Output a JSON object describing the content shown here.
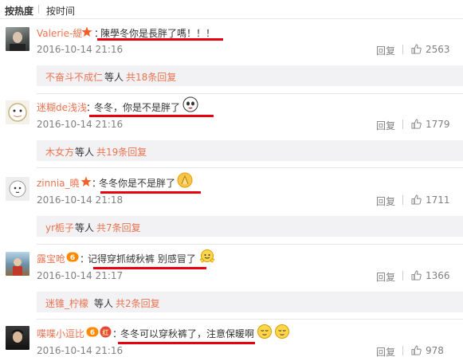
{
  "tabs": {
    "hot": "按热度",
    "time": "按时间"
  },
  "colors": {
    "accent": "#eb7350",
    "underline": "#e60012",
    "muted": "#808080",
    "sub_bg": "#f2f2f5"
  },
  "comments": [
    {
      "nickname": "Valerie-緹",
      "badges": [
        "star-icon"
      ],
      "text": "陳學冬你是長胖了嗎！！！",
      "emojis": [],
      "time": "2016-10-14 21:16",
      "reply_label": "回复",
      "likes": "2563",
      "sub_names": "不奋斗不成仁",
      "sub_deng": "等人",
      "sub_total": "共18条回复"
    },
    {
      "nickname": "迷糊de浅浅",
      "badges": [],
      "text": "冬冬，你是不是胖了",
      "emojis": [
        "doge-emoji"
      ],
      "time": "2016-10-14 21:16",
      "reply_label": "回复",
      "likes": "1779",
      "sub_names": "木女方",
      "sub_deng": "等人",
      "sub_total": "共19条回复"
    },
    {
      "nickname": "zinnia_曉",
      "badges": [
        "star-icon"
      ],
      "text": "冬冬你是不是胖了",
      "emojis": [
        "pray-emoji"
      ],
      "time": "2016-10-14 21:18",
      "reply_label": "回复",
      "likes": "1711",
      "sub_names": "yr栀子",
      "sub_deng": "等人",
      "sub_total": "共7条回复"
    },
    {
      "nickname": "露宝呛",
      "badges": [
        "vip-icon"
      ],
      "text": "记得穿抓绒秋裤 别感冒了",
      "emojis": [
        "hug-emoji"
      ],
      "time": "2016-10-14 21:17",
      "reply_label": "回复",
      "likes": "1366",
      "sub_names": "迷锥_柠檬",
      "sub_deng": "等人",
      "sub_total": "共2条回复"
    },
    {
      "nickname": "喋喋小逗比",
      "badges": [
        "vip-icon",
        "red-envelope-icon"
      ],
      "text": "冬冬可以穿秋裤了，注意保暖啊",
      "emojis": [
        "relieved-emoji",
        "relieved-emoji"
      ],
      "time": "2016-10-14 21:16",
      "reply_label": "回复",
      "likes": "978"
    }
  ]
}
